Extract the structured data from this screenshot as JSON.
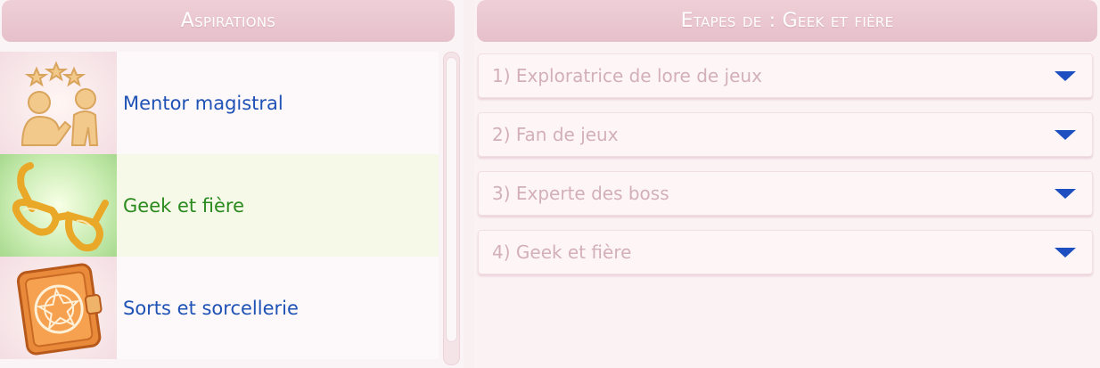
{
  "left_panel": {
    "title": "Aspirations",
    "items": [
      {
        "label": "Mentor magistral",
        "icon": "mentor-icon",
        "selected": false
      },
      {
        "label": "Geek et fière",
        "icon": "glasses-icon",
        "selected": true
      },
      {
        "label": "Sorts et sorcellerie",
        "icon": "spellbook-icon",
        "selected": false
      }
    ]
  },
  "right_panel": {
    "title_prefix": "Etapes de",
    "title_name": ": Geek et fière",
    "steps": [
      {
        "label": "1) Exploratrice de lore de jeux",
        "icon": "chevron-down-icon"
      },
      {
        "label": "2) Fan de jeux",
        "icon": "chevron-down-icon"
      },
      {
        "label": "3) Experte des boss",
        "icon": "chevron-down-icon"
      },
      {
        "label": "4) Geek et fière",
        "icon": "chevron-down-icon"
      }
    ]
  },
  "colors": {
    "header": "#e8c4cd",
    "item_label": "#1f52b5",
    "selected_label": "#2a8a1e",
    "step_text": "#d3b0b8",
    "chevron": "#1e4fc1"
  }
}
